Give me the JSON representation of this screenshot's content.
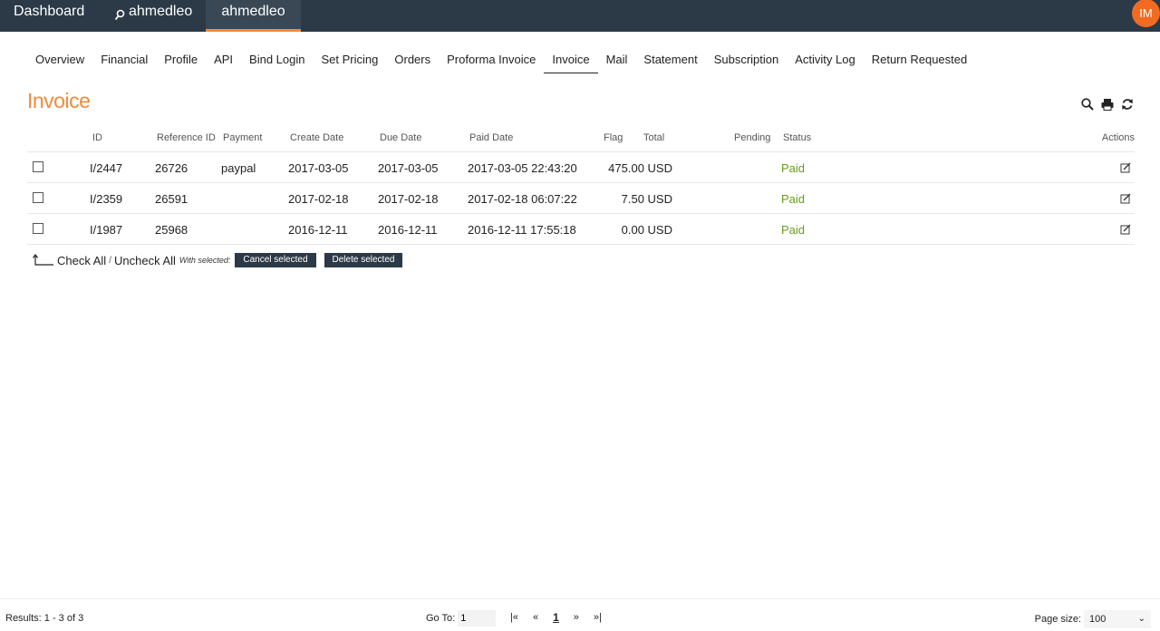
{
  "topbar": {
    "dashboard": "Dashboard",
    "search_label": "ahmedleo",
    "user_tab": "ahmedleo",
    "avatar_initials": "IM"
  },
  "tabs": [
    "Overview",
    "Financial",
    "Profile",
    "API",
    "Bind Login",
    "Set Pricing",
    "Orders",
    "Proforma Invoice",
    "Invoice",
    "Mail",
    "Statement",
    "Subscription",
    "Activity Log",
    "Return Requested"
  ],
  "active_tab": "Invoice",
  "page": {
    "title": "Invoice"
  },
  "toolbar": {
    "icons": [
      "search-icon",
      "print-icon",
      "refresh-icon"
    ]
  },
  "table": {
    "headers": {
      "id": "ID",
      "reference": "Reference ID",
      "payment": "Payment",
      "create_date": "Create Date",
      "due_date": "Due Date",
      "paid_date": "Paid Date",
      "flag": "Flag",
      "total": "Total",
      "pending": "Pending",
      "status": "Status",
      "actions": "Actions"
    },
    "rows": [
      {
        "id": "I/2447",
        "reference": "26726",
        "payment": "paypal",
        "create_date": "2017-03-05",
        "due_date": "2017-03-05",
        "paid_date": "2017-03-05 22:43:20",
        "flag": "",
        "total": "475.00 USD",
        "pending": "",
        "status": "Paid"
      },
      {
        "id": "I/2359",
        "reference": "26591",
        "payment": "",
        "create_date": "2017-02-18",
        "due_date": "2017-02-18",
        "paid_date": "2017-02-18 06:07:22",
        "flag": "",
        "total": "7.50 USD",
        "pending": "",
        "status": "Paid"
      },
      {
        "id": "I/1987",
        "reference": "25968",
        "payment": "",
        "create_date": "2016-12-11",
        "due_date": "2016-12-11",
        "paid_date": "2016-12-11 17:55:18",
        "flag": "",
        "total": "0.00 USD",
        "pending": "",
        "status": "Paid"
      }
    ]
  },
  "bulk": {
    "check_all": "Check All",
    "separator": "/",
    "uncheck_all": "Uncheck All",
    "with_selected": "With selected:",
    "cancel_selected": "Cancel selected",
    "delete_selected": "Delete selected"
  },
  "footer": {
    "results": "Results: 1 - 3 of 3",
    "goto_label": "Go To:",
    "goto_value": "1",
    "first": "|«",
    "prev": "«",
    "current_page": "1",
    "next": "»",
    "last": "»|",
    "page_size_label": "Page size:",
    "page_size_value": "100"
  },
  "colors": {
    "topbar_bg": "#2c3a47",
    "accent": "#f08a3c",
    "avatar_bg": "#f26b21",
    "paid_status": "#6a9a1f"
  }
}
